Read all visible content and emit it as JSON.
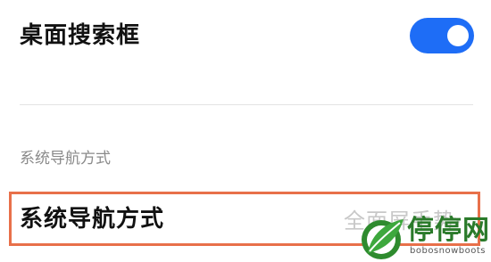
{
  "desktop_search": {
    "label": "桌面搜索框",
    "enabled": true
  },
  "navigation_section": {
    "header": "系统导航方式",
    "row": {
      "label": "系统导航方式",
      "value": "全面屏手势",
      "chevron": "›"
    }
  },
  "colors": {
    "toggle_on": "#1e6df6",
    "highlight_frame": "#e8704a",
    "section_header": "#8a8a8a"
  },
  "watermark": {
    "brand": "停停网",
    "url": "bobosnowboots"
  }
}
